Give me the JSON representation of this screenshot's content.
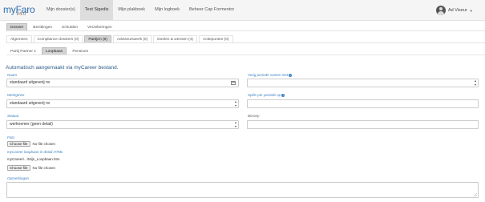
{
  "app": {
    "brand": "myFaro",
    "version": "V4.0"
  },
  "nav": {
    "items": [
      {
        "label": "Mijn dossier(s)",
        "active": false
      },
      {
        "label": "Test Sigedis",
        "active": true
      },
      {
        "label": "Mijn plakboek",
        "active": false
      },
      {
        "label": "Mijn logboek",
        "active": false
      },
      {
        "label": "Beheer Cap Formentor",
        "active": false
      }
    ],
    "user": "Ad Viseur"
  },
  "tabs_primary": [
    {
      "label": "Dossier",
      "active": true
    },
    {
      "label": "Bezittingen",
      "active": false
    },
    {
      "label": "Schulden",
      "active": false
    },
    {
      "label": "Verzekeringen",
      "active": false
    }
  ],
  "tabs_secondary": [
    {
      "label": "Algemeen",
      "active": false
    },
    {
      "label": "Compliance dossiers (0)",
      "active": false
    },
    {
      "label": "Partijen (8)",
      "active": true
    },
    {
      "label": "Adviseurswerk (0)",
      "active": false
    },
    {
      "label": "Doelen & wensen (4)",
      "active": false
    },
    {
      "label": "Actiepunten (0)",
      "active": false
    }
  ],
  "tabs_tertiary": [
    {
      "label": "Partij Partner 1",
      "active": false
    },
    {
      "label": "Loopbaan",
      "active": true
    },
    {
      "label": "Pensioen",
      "active": false
    }
  ],
  "form": {
    "section_title": "Automatisch aangemaakt via myCareer bestand.",
    "naam_label": "Naam",
    "naam_value": "standaard uitgeverij nv",
    "werkgever_label": "Werkgever",
    "werkgever_value": "standaard uitgeverij nv",
    "statuut_label": "Statuut",
    "statuut_value": "werknemer (geen detail)",
    "foto_label": "Foto",
    "file_button": "Choose file",
    "no_file": "No file chosen",
    "html_label": "myCareer loopbaan in detail HTML",
    "html_path": "myCareer\\...\\Mijn_Loopbaan.htm",
    "vorig_label": "Vorig periode samen met",
    "splits_label": "Splits per periode op",
    "beroep_label": "Beroep",
    "opmerkingen_label": "Opmerkingen"
  }
}
